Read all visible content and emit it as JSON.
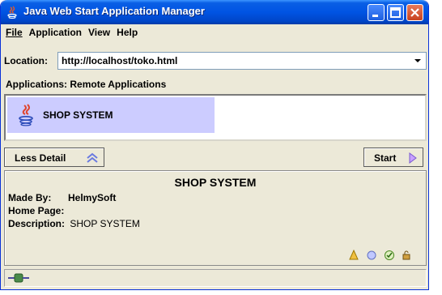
{
  "window": {
    "title": "Java Web Start Application Manager"
  },
  "menu": {
    "items": [
      {
        "label": "File",
        "mnemonic": "F"
      },
      {
        "label": "Application",
        "mnemonic": "A"
      },
      {
        "label": "View",
        "mnemonic": "V"
      },
      {
        "label": "Help",
        "mnemonic": "H"
      }
    ]
  },
  "location": {
    "label": "Location:",
    "value": "http://localhost/toko.html"
  },
  "applications": {
    "label": "Applications:",
    "category": "Remote Applications",
    "items": [
      {
        "name": "SHOP SYSTEM",
        "selected": true
      }
    ]
  },
  "buttons": {
    "less_detail": "Less Detail",
    "start": "Start"
  },
  "details": {
    "title": "SHOP SYSTEM",
    "made_by_label": "Made By:",
    "made_by_value": "HelmySoft",
    "home_page_label": "Home Page:",
    "home_page_value": "",
    "description_label": "Description:",
    "description_value": "SHOP SYSTEM"
  },
  "colors": {
    "titlebar": "#0054e3",
    "selection": "#ccccff",
    "window_bg": "#ece9d8"
  }
}
